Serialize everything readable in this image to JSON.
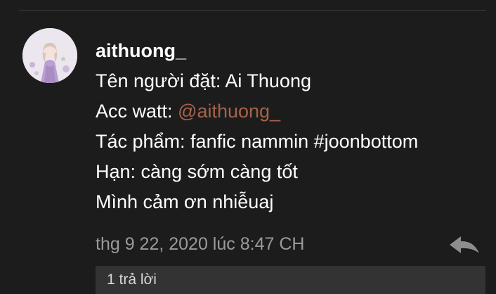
{
  "comment": {
    "username": "aithuong_",
    "lines": {
      "name_label": "Tên người đặt: Ai Thuong",
      "acc_prefix": "Acc watt: ",
      "acc_mention": "@aithuong_",
      "work": "Tác phẩm: fanfic nammin #joonbottom",
      "deadline": "Hạn: càng sớm càng tốt",
      "thanks": "Mình cảm ơn nhiễuaj"
    },
    "timestamp": "thg 9 22, 2020 lúc 8:47 CH",
    "reply_count_label": "1 trả lời"
  },
  "colors": {
    "background": "#1c1c1c",
    "text": "#ffffff",
    "mention": "#a6634a",
    "meta": "#9a9a9a",
    "reply_bar": "#333333"
  },
  "icons": {
    "avatar": "user-avatar",
    "reply": "reply-arrow-icon"
  }
}
